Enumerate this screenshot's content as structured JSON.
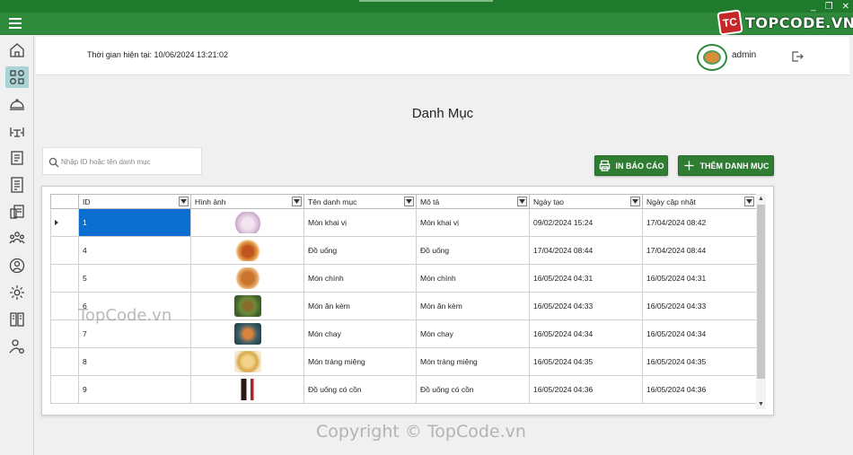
{
  "brand": {
    "logo_text": "TC",
    "text": "TOPCODE.VN"
  },
  "window": {
    "controls": [
      "_",
      "❐",
      "✕"
    ]
  },
  "sidebar": {
    "items": [
      {
        "icon": "home-icon"
      },
      {
        "icon": "category-grid-icon",
        "active": true
      },
      {
        "icon": "dish-icon"
      },
      {
        "icon": "tables-icon"
      },
      {
        "icon": "menu-board-icon"
      },
      {
        "icon": "invoice-icon"
      },
      {
        "icon": "report-icon"
      },
      {
        "icon": "staff-icon"
      },
      {
        "icon": "account-icon"
      },
      {
        "icon": "settings-icon"
      },
      {
        "icon": "book-icon"
      },
      {
        "icon": "user-manage-icon"
      }
    ]
  },
  "header": {
    "time_label": "Thời gian hiện tại: 10/06/2024 13:21:02",
    "username": "admin"
  },
  "page": {
    "title": "Danh Mục"
  },
  "search": {
    "placeholder": "Nhập ID hoặc tên danh mục",
    "value": ""
  },
  "actions": {
    "print_label": "IN BÁO CÁO",
    "add_label": "THÊM DANH MỤC"
  },
  "table": {
    "columns": [
      "ID",
      "Hình ảnh",
      "Tên danh mục",
      "Mô tả",
      "Ngày tạo",
      "Ngày cập nhật"
    ],
    "rows": [
      {
        "id": "1",
        "image": "appetizer",
        "name": "Món khai vị",
        "desc": "Món khai vị",
        "created": "09/02/2024 15:24",
        "updated": "17/04/2024 08:42"
      },
      {
        "id": "4",
        "image": "drink",
        "name": "Đồ uống",
        "desc": "Đồ uống",
        "created": "17/04/2024 08:44",
        "updated": "17/04/2024 08:44"
      },
      {
        "id": "5",
        "image": "main-dish",
        "name": "Món chính",
        "desc": "Món chính",
        "created": "16/05/2024 04:31",
        "updated": "16/05/2024 04:31"
      },
      {
        "id": "6",
        "image": "side-dish",
        "name": "Món ăn kèm",
        "desc": "Món ăn kèm",
        "created": "16/05/2024 04:33",
        "updated": "16/05/2024 04:33"
      },
      {
        "id": "7",
        "image": "vegetarian",
        "name": "Món chay",
        "desc": "Món chay",
        "created": "16/05/2024 04:34",
        "updated": "16/05/2024 04:34"
      },
      {
        "id": "8",
        "image": "dessert",
        "name": "Món tráng miệng",
        "desc": "Món tráng miệng",
        "created": "16/05/2024 04:35",
        "updated": "16/05/2024 04:35"
      },
      {
        "id": "9",
        "image": "alcohol",
        "name": "Đồ uống có cồn",
        "desc": "Đồ uống có cồn",
        "created": "16/05/2024 04:36",
        "updated": "16/05/2024 04:36"
      }
    ]
  },
  "watermarks": {
    "side": "TopCode.vn",
    "bottom": "Copyright © TopCode.vn"
  },
  "colors": {
    "primary_green": "#2e7d32",
    "header_green": "#1f7a2e",
    "selection_blue": "#0a6fd1"
  }
}
